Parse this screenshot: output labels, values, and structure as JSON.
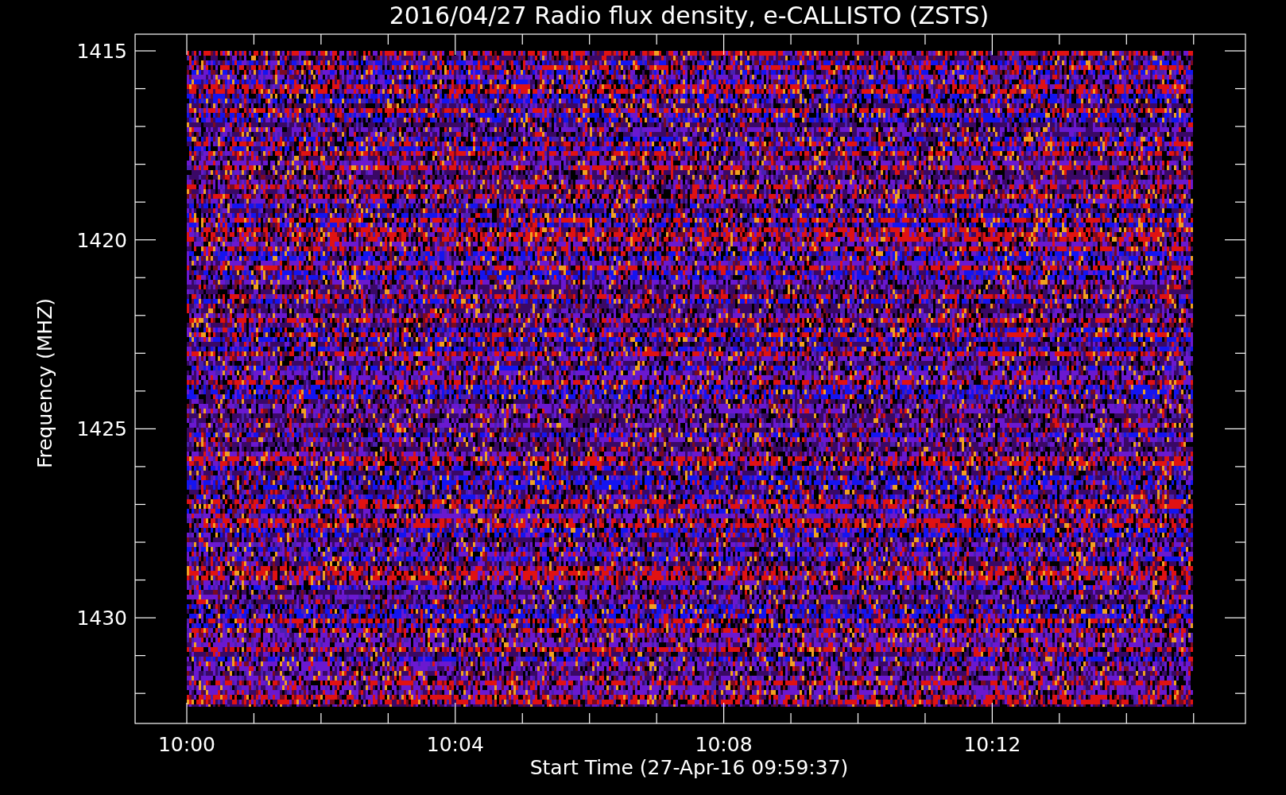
{
  "title": "2016/04/27  Radio flux density, e-CALLISTO (ZSTS)",
  "y_axis": {
    "label": "Frequency (MHZ)",
    "ticks": [
      "1415",
      "1420",
      "1425",
      "1430"
    ]
  },
  "x_axis": {
    "label": "Start Time (27-Apr-16 09:59:37)",
    "ticks": [
      "10:00",
      "10:04",
      "10:08",
      "10:12"
    ]
  }
}
